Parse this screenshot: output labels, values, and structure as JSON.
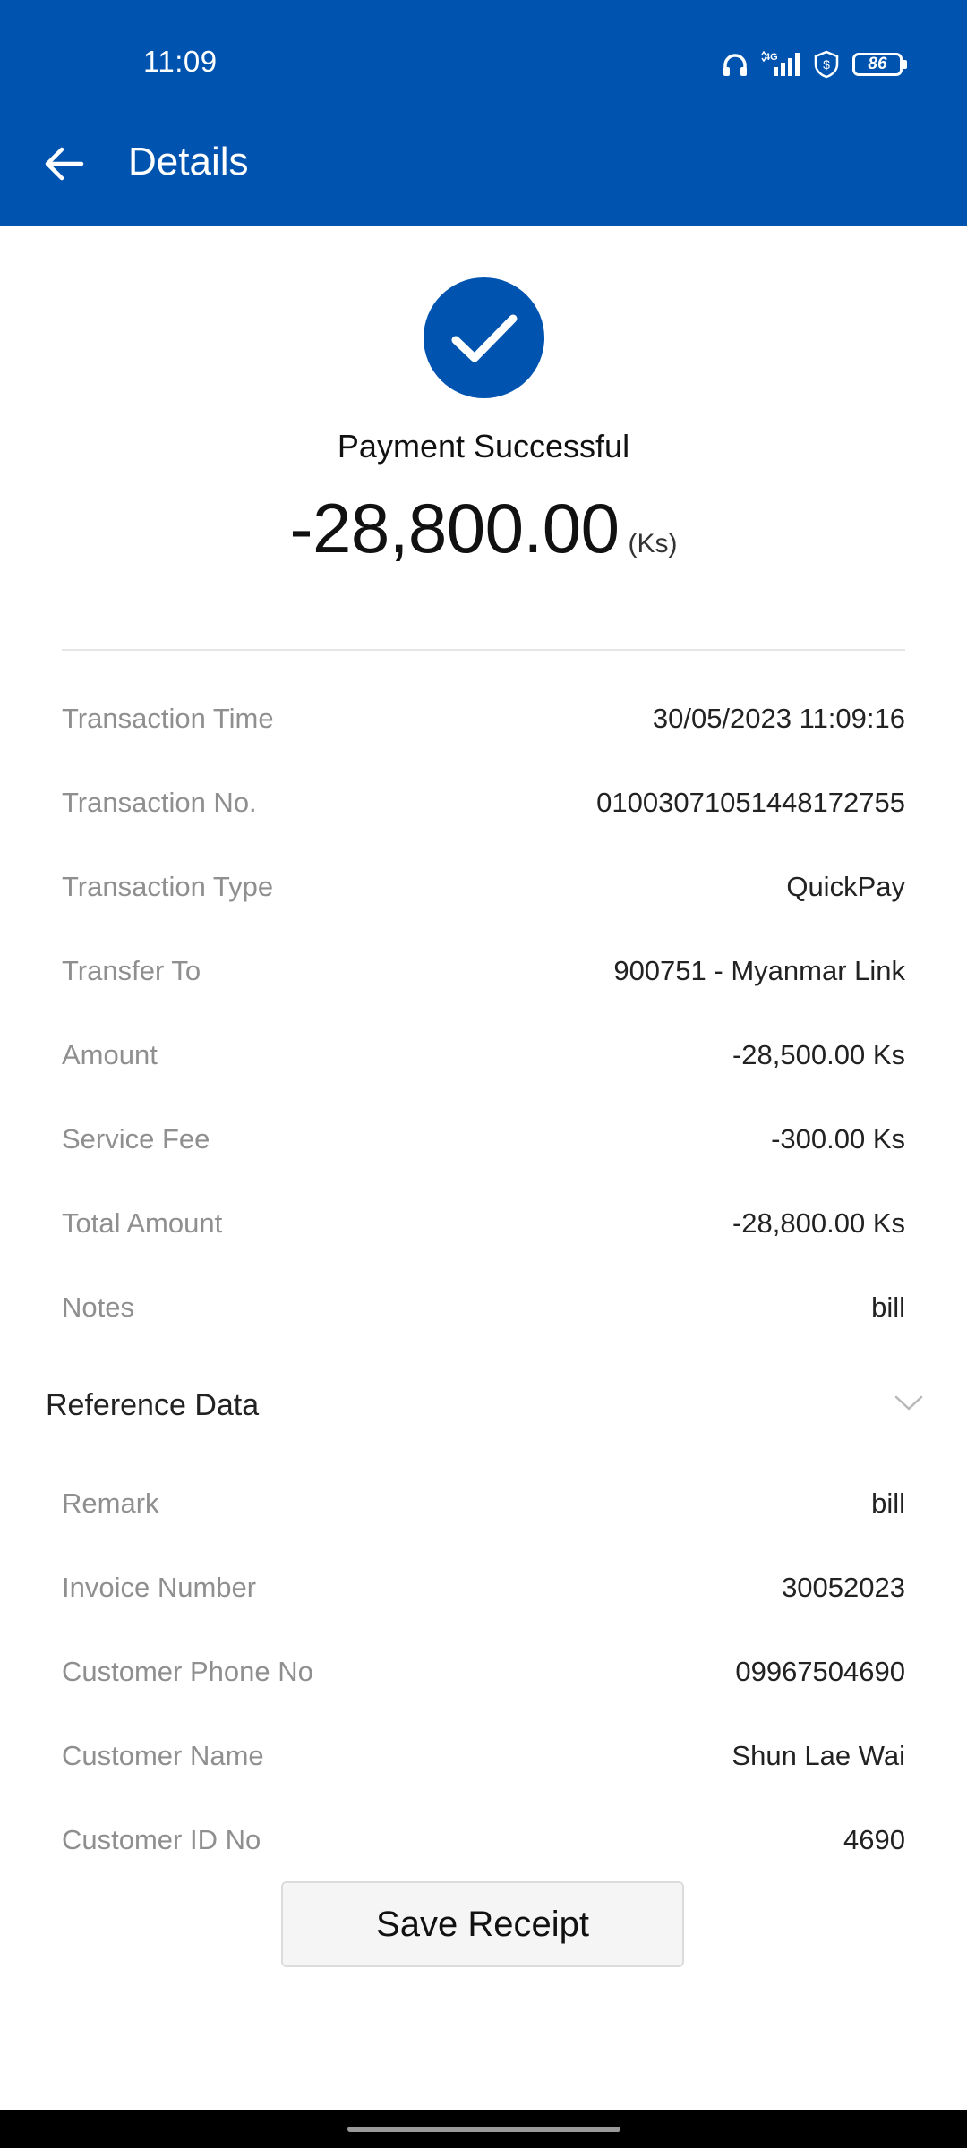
{
  "status_bar": {
    "time": "11:09",
    "battery": "86",
    "network": "4G"
  },
  "header": {
    "title": "Details",
    "back_icon": "arrow-left-icon",
    "background": "#0054b0"
  },
  "summary": {
    "icon": "check-circle-icon",
    "status": "Payment Successful",
    "amount": "-28,800.00",
    "unit": "(Ks)"
  },
  "details": [
    {
      "label": "Transaction Time",
      "value": "30/05/2023 11:09:16"
    },
    {
      "label": "Transaction No.",
      "value": "01003071051448172755"
    },
    {
      "label": "Transaction Type",
      "value": "QuickPay"
    },
    {
      "label": "Transfer To",
      "value": "900751 - Myanmar Link"
    },
    {
      "label": "Amount",
      "value": "-28,500.00 Ks"
    },
    {
      "label": "Service Fee",
      "value": "-300.00 Ks"
    },
    {
      "label": "Total Amount",
      "value": "-28,800.00 Ks"
    },
    {
      "label": "Notes",
      "value": "bill"
    }
  ],
  "reference": {
    "title": "Reference Data",
    "toggle_icon": "chevron-down-icon",
    "items": [
      {
        "label": "Remark",
        "value": "bill"
      },
      {
        "label": "Invoice Number",
        "value": "30052023"
      },
      {
        "label": "Customer Phone No",
        "value": "09967504690"
      },
      {
        "label": "Customer Name",
        "value": "Shun Lae Wai"
      },
      {
        "label": "Customer ID No",
        "value": "4690"
      }
    ]
  },
  "actions": {
    "save_receipt": "Save Receipt"
  }
}
